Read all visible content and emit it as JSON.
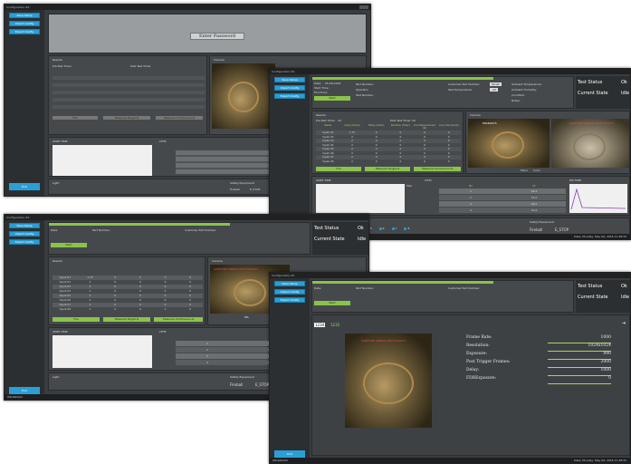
{
  "window_title": "Configuration #1",
  "sidebar": {
    "buttons": [
      "Save Setup",
      "Import Config",
      "Export Config"
    ],
    "exit_label": "Exit"
  },
  "password_prompt": "Enter Password",
  "results": {
    "title": "Results",
    "pre_test_timer_label": "Pre-Test Timer",
    "pre_test_timer_value": "20",
    "post_test_timer_label": "Post Test Timer",
    "post_test_timer_value": "20",
    "columns": [
      "Name",
      "Amp (mAmp)",
      "Delay (mSec)",
      "Duration (mSec)",
      "Line Measurement (Ω)",
      "Line Channel (Ω)"
    ],
    "rows": [
      [
        "Squib 01",
        "1.75",
        "0",
        "0",
        "0",
        "0"
      ],
      [
        "Squib 02",
        "2",
        "0",
        "0",
        "0",
        "0"
      ],
      [
        "Squib 03",
        "2",
        "0",
        "0",
        "0",
        "0"
      ],
      [
        "Squib 04",
        "2",
        "0",
        "0",
        "0",
        "0"
      ],
      [
        "Squib 05",
        "2",
        "0",
        "0",
        "0",
        "0"
      ],
      [
        "Squib 06",
        "2",
        "0",
        "0",
        "0",
        "0"
      ],
      [
        "Squib 07",
        "2",
        "0",
        "0",
        "0",
        "0"
      ],
      [
        "Squib 08",
        "2",
        "0",
        "0",
        "0",
        "0"
      ]
    ],
    "buttons": [
      "Fire",
      "Measure Single Ω",
      "Measure Continuous Ω"
    ]
  },
  "camera": {
    "title": "Camera",
    "brand": "MICROSYS",
    "overlay": "SUREFIRE AIRBAG TEST FACILITY",
    "options": [
      "Mono",
      "Color"
    ],
    "percent": "0%"
  },
  "sections": {
    "amps_time": "AMPS TIME",
    "ltm": "LTTM",
    "pw_time": "PW TIME",
    "max": "Max",
    "light": "Light",
    "safety": "Safety Equipment",
    "fireball": "Fireball",
    "estop": "E_STOP"
  },
  "ltm_table": {
    "columns": [
      "No",
      "LT"
    ],
    "rows": [
      [
        "1",
        "98.3"
      ],
      [
        "2",
        "31.0"
      ],
      [
        "3",
        "38.2"
      ],
      [
        "4",
        "31.6"
      ]
    ]
  },
  "light_items": [
    "1",
    "2",
    "3",
    "4",
    "5",
    "6",
    "7",
    "8"
  ],
  "form_labels": {
    "date": "Date:",
    "date_value": "05-09-2016",
    "start_time": "Start Time:",
    "start_time_value": "11:44:44",
    "end_time": "End Time:",
    "end_time_value": "11:45:13",
    "part_number": "Part Number:",
    "operator": "Operator:",
    "test_number": "Test Number:",
    "customer_part_number": "Customer Part Number:",
    "test_temperature": "Test Temperature:",
    "humidity": "Humidity:",
    "ambient_temperature": "Ambient Temperature:",
    "ambient_humidity": "Ambient Humidity:",
    "condition": "Condition:",
    "notes": "Notes:",
    "start_button": "Start",
    "dropdown_1": "Perish",
    "dropdown_2": "-20"
  },
  "test_status": {
    "status_label": "Test Status",
    "status_value": "Ok",
    "state_label": "Current State",
    "state_value": "Idle"
  },
  "video": {
    "frame_counter_a": "1234",
    "frame_counter_b": "1235",
    "fields": [
      {
        "label": "Frame Rate:",
        "value": "1000"
      },
      {
        "label": "Resolution:",
        "value": "1024x1024"
      },
      {
        "label": "Exposure:",
        "value": "990"
      },
      {
        "label": "Post Trigger Frames:",
        "value": "2000"
      },
      {
        "label": "Delay:",
        "value": "1000"
      },
      {
        "label": "FDRExposure:",
        "value": "0"
      }
    ]
  },
  "footer": {
    "brand": "UltraShield",
    "date_text": "Date: Monday, May 09, 2016 11:48:32"
  },
  "colors": {
    "accent_blue": "#2a9fd6",
    "accent_green": "#8bc34a",
    "background": "#3a3d40"
  }
}
